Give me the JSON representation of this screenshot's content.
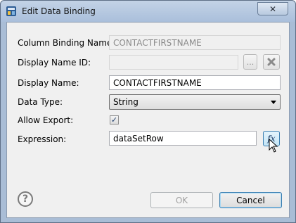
{
  "window": {
    "title": "Edit Data Binding",
    "close_icon": "close-icon"
  },
  "form": {
    "column_binding_name": {
      "label": "Column Binding Name:",
      "value": "CONTACTFIRSTNAME"
    },
    "display_name_id": {
      "label": "Display Name ID:",
      "value": "",
      "browse_label": "...",
      "clear_icon": "clear-x-icon"
    },
    "display_name": {
      "label": "Display Name:",
      "value": "CONTACTFIRSTNAME"
    },
    "data_type": {
      "label": "Data Type:",
      "selected": "String"
    },
    "allow_export": {
      "label": "Allow Export:",
      "checked": true,
      "check_mark": "✓"
    },
    "expression": {
      "label": "Expression:",
      "value": "dataSetRow",
      "fx_label": "fx"
    }
  },
  "footer": {
    "help_icon": "?",
    "ok_label": "OK",
    "cancel_label": "Cancel"
  }
}
